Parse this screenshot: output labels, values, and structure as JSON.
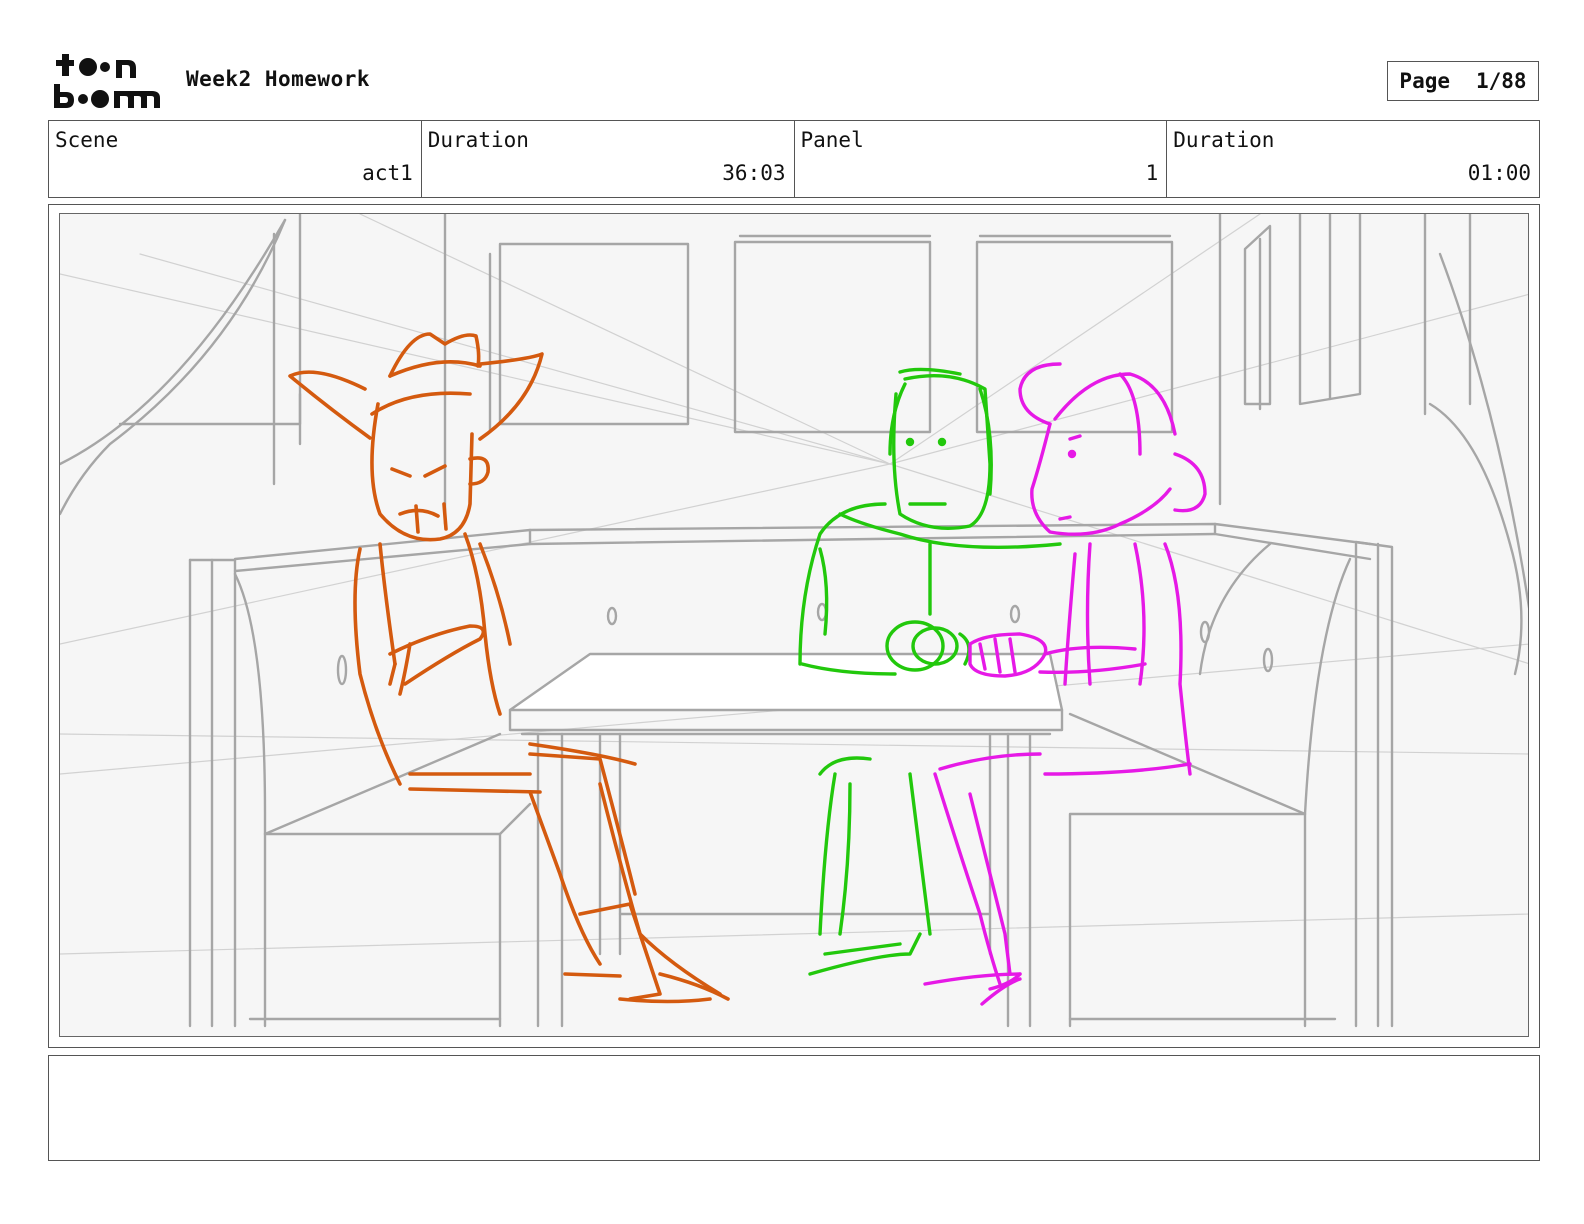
{
  "header": {
    "logo": {
      "icon": "toon-boom-logo",
      "text": "toon boom"
    },
    "project_title": "Week2 Homework",
    "page_label": "Page",
    "page_number": "1/88"
  },
  "info": {
    "scene_label": "Scene",
    "scene_value": "act1",
    "scene_duration_label": "Duration",
    "scene_duration_value": "36:03",
    "panel_label": "Panel",
    "panel_value": "1",
    "panel_duration_label": "Duration",
    "panel_duration_value": "01:00"
  },
  "panel": {
    "drawing": "booth-scene-sketch",
    "colors": {
      "background": "#f6f6f6",
      "set_lines": "#a6a6a6",
      "character_cowboy": "#d45a0f",
      "character_green": "#22c80c",
      "character_magenta": "#e619e6"
    }
  },
  "notes": {
    "text": ""
  }
}
